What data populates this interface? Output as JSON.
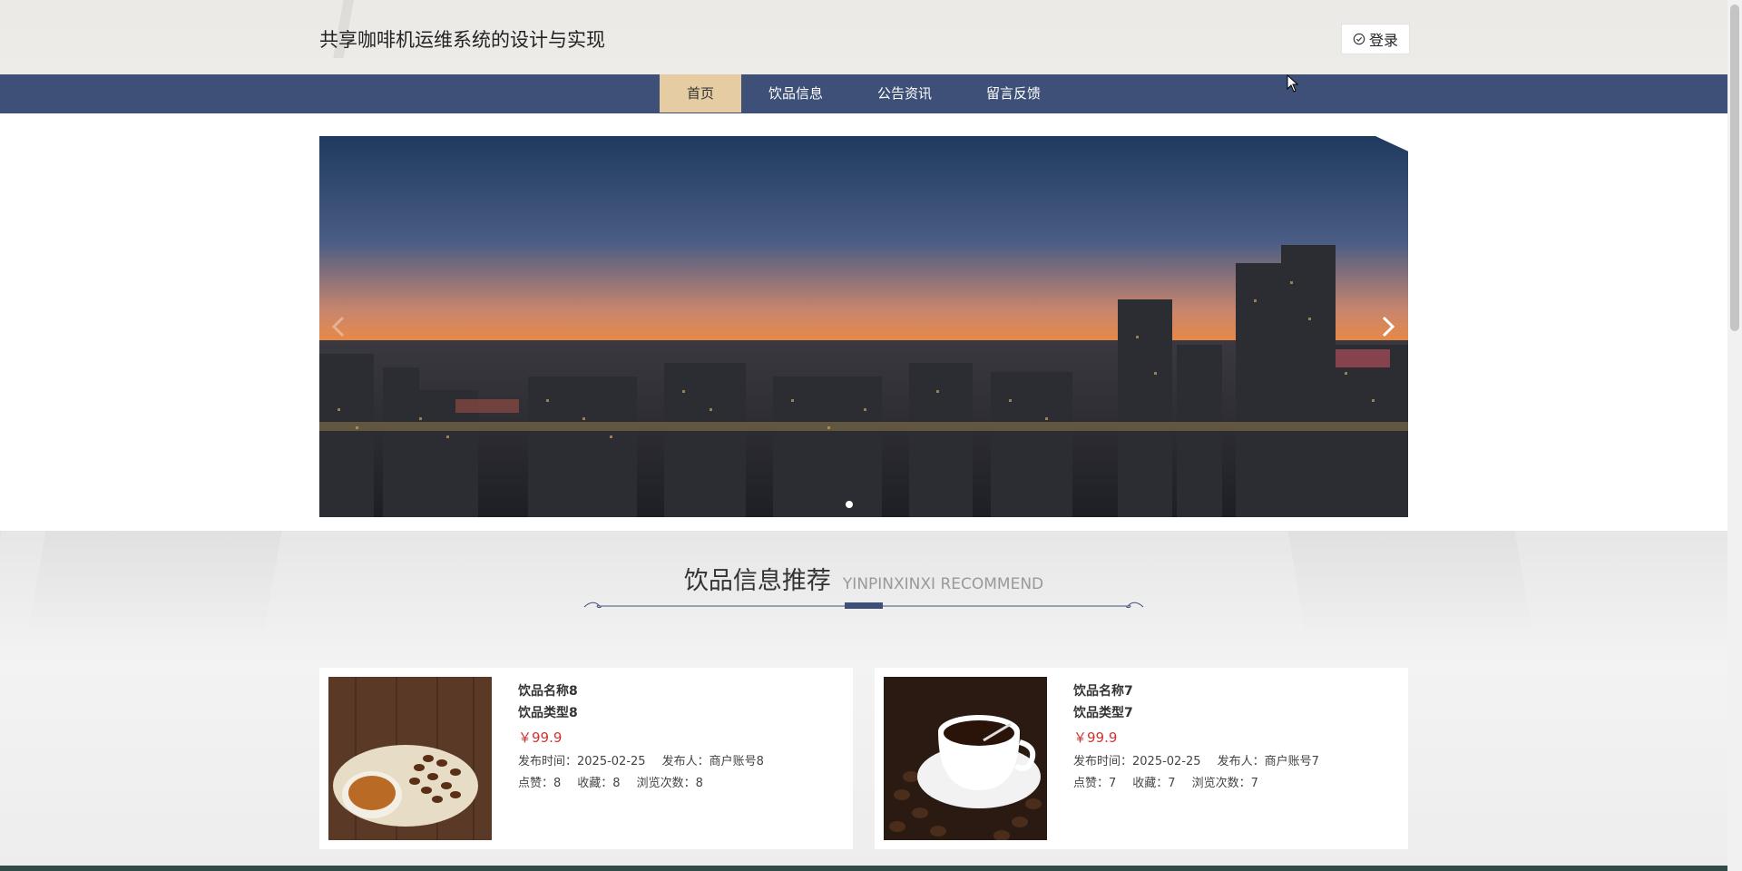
{
  "header": {
    "site_title": "共享咖啡机运维系统的设计与实现",
    "login_label": "登录"
  },
  "nav": {
    "items": [
      {
        "label": "首页",
        "active": true
      },
      {
        "label": "饮品信息",
        "active": false
      },
      {
        "label": "公告资讯",
        "active": false
      },
      {
        "label": "留言反馈",
        "active": false
      }
    ]
  },
  "banner": {
    "slide_count": 1,
    "active_slide": 1
  },
  "section": {
    "title_cn": "饮品信息推荐",
    "title_en": "YINPINXINXI RECOMMEND"
  },
  "products": [
    {
      "name": "饮品名称8",
      "type": "饮品类型8",
      "price": "￥99.9",
      "publish_time": "发布时间：2025-02-25",
      "publisher": "发布人：商户账号8",
      "likes": "点赞：8",
      "favorites": "收藏：8",
      "views": "浏览次数：8"
    },
    {
      "name": "饮品名称7",
      "type": "饮品类型7",
      "price": "￥99.9",
      "publish_time": "发布时间：2025-02-25",
      "publisher": "发布人：商户账号7",
      "likes": "点赞：7",
      "favorites": "收藏：7",
      "views": "浏览次数：7"
    }
  ],
  "colors": {
    "nav_bg": "#3e5078",
    "nav_active": "#e5cca3",
    "price": "#d1332f"
  }
}
